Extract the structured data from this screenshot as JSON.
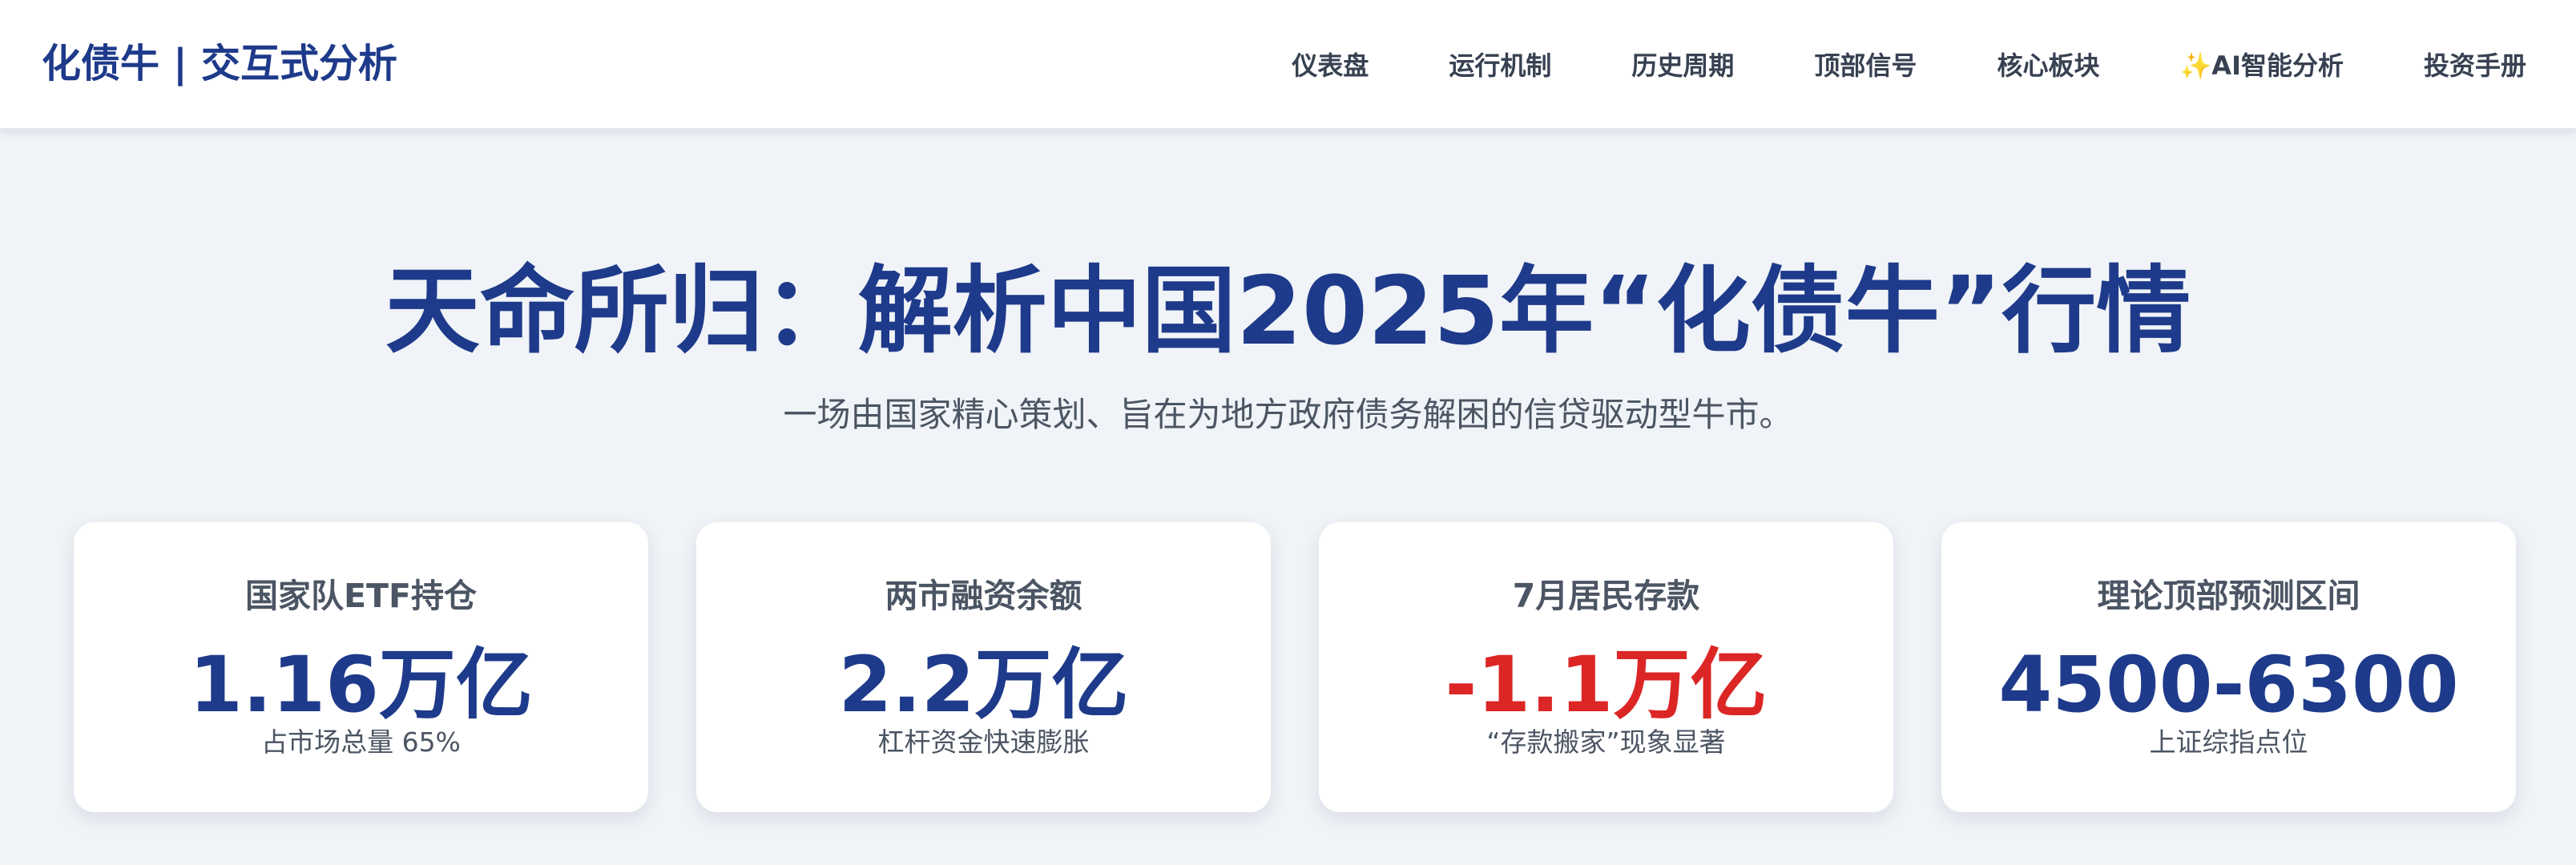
{
  "header": {
    "brand": "化债牛 | 交互式分析",
    "nav": [
      {
        "label": "仪表盘"
      },
      {
        "label": "运行机制"
      },
      {
        "label": "历史周期"
      },
      {
        "label": "顶部信号"
      },
      {
        "label": "核心板块"
      },
      {
        "icon": "sparkle-icon",
        "icon_glyph": "✨",
        "label": "AI智能分析"
      },
      {
        "label": "投资手册"
      }
    ]
  },
  "hero": {
    "title": "天命所归：解析中国2025年“化债牛”行情",
    "subtitle": "一场由国家精心策划、旨在为地方政府债务解困的信贷驱动型牛市。"
  },
  "stats": [
    {
      "label": "国家队ETF持仓",
      "value": "1.16万亿",
      "note": "占市场总量 65%",
      "color": "#1e3a8a"
    },
    {
      "label": "两市融资余额",
      "value": "2.2万亿",
      "note": "杠杆资金快速膨胀",
      "color": "#1e3a8a"
    },
    {
      "label": "7月居民存款",
      "value": "-1.1万亿",
      "note": "“存款搬家”现象显著",
      "color": "#dc2626"
    },
    {
      "label": "理论顶部预测区间",
      "value": "4500-6300",
      "note": "上证综指点位",
      "color": "#1e3a8a"
    }
  ],
  "colors": {
    "brand": "#1e3a8a",
    "negative": "#dc2626",
    "background": "#f0f3f7",
    "card": "#ffffff"
  }
}
